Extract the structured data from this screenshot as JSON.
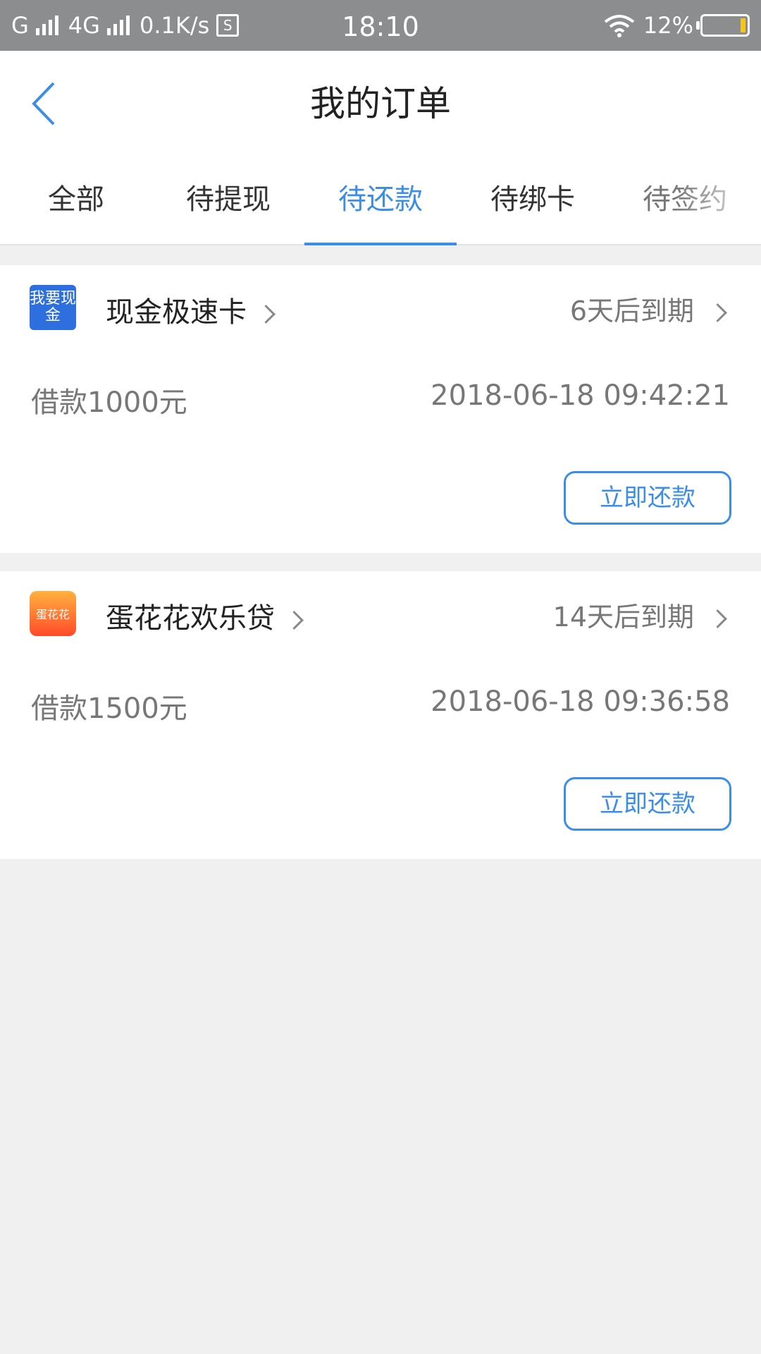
{
  "status_bar": {
    "carrier1": "G",
    "network": "4G",
    "speed": "0.1K/s",
    "sim_icon": "S",
    "time": "18:10",
    "battery": "12%"
  },
  "header": {
    "title": "我的订单"
  },
  "tabs": [
    {
      "label": "全部"
    },
    {
      "label": "待提现"
    },
    {
      "label": "待还款"
    },
    {
      "label": "待绑卡"
    },
    {
      "label": "待签约"
    }
  ],
  "orders": [
    {
      "product": "现金极速卡",
      "logo_text": "我要现金",
      "due": "6天后到期",
      "amount": "借款1000元",
      "datetime": "2018-06-18 09:42:21",
      "action": "立即还款"
    },
    {
      "product": "蛋花花欢乐贷",
      "logo_text": "蛋花花",
      "due": "14天后到期",
      "amount": "借款1500元",
      "datetime": "2018-06-18 09:36:58",
      "action": "立即还款"
    }
  ],
  "colors": {
    "accent": "#3b8ee8",
    "status_bar": "#8b8d8f",
    "background": "#f0f0f0"
  }
}
